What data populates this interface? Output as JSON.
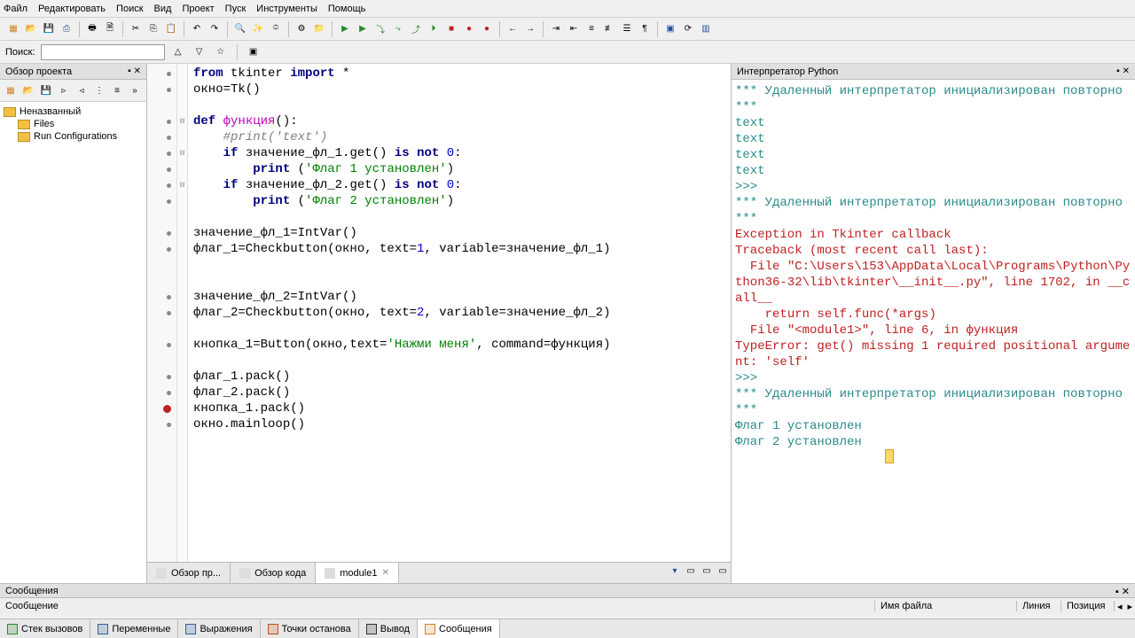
{
  "menu": {
    "file": "Файл",
    "edit": "Редактировать",
    "search": "Поиск",
    "view": "Вид",
    "project": "Проект",
    "run": "Пуск",
    "tools": "Инструменты",
    "help": "Помощь"
  },
  "search": {
    "label": "Поиск:",
    "value": ""
  },
  "sidebar": {
    "title": "Обзор проекта",
    "nodes": [
      {
        "label": "Неназванный",
        "indent": 0
      },
      {
        "label": "Files",
        "indent": 1
      },
      {
        "label": "Run Configurations",
        "indent": 1
      }
    ]
  },
  "editor": {
    "tabs": [
      {
        "label": "Обзор пр...",
        "closable": false
      },
      {
        "label": "Обзор кода",
        "closable": false
      },
      {
        "label": "module1",
        "closable": true,
        "active": true
      }
    ],
    "breakpoint_line": 22,
    "code": [
      {
        "t": "line",
        "spans": [
          {
            "c": "kw",
            "t": "from"
          },
          {
            "t": " tkinter "
          },
          {
            "c": "kw",
            "t": "import"
          },
          {
            "t": " *"
          }
        ]
      },
      {
        "t": "line",
        "spans": [
          {
            "t": "окно=Tk()"
          }
        ]
      },
      {
        "t": "blank"
      },
      {
        "t": "line",
        "fold": "-",
        "spans": [
          {
            "c": "kw",
            "t": "def"
          },
          {
            "t": " "
          },
          {
            "c": "fn",
            "t": "функция"
          },
          {
            "t": "():"
          }
        ]
      },
      {
        "t": "line",
        "spans": [
          {
            "t": "    "
          },
          {
            "c": "cm",
            "t": "#print('text')"
          }
        ]
      },
      {
        "t": "line",
        "fold": "-",
        "spans": [
          {
            "t": "    "
          },
          {
            "c": "kw",
            "t": "if"
          },
          {
            "t": " значение_фл_1.get() "
          },
          {
            "c": "kw",
            "t": "is not"
          },
          {
            "t": " "
          },
          {
            "c": "nm",
            "t": "0"
          },
          {
            "t": ":"
          }
        ]
      },
      {
        "t": "line",
        "spans": [
          {
            "t": "        "
          },
          {
            "c": "kw",
            "t": "print"
          },
          {
            "t": " ("
          },
          {
            "c": "str",
            "t": "'Флаг 1 установлен'"
          },
          {
            "t": ")"
          }
        ]
      },
      {
        "t": "line",
        "fold": "-",
        "spans": [
          {
            "t": "    "
          },
          {
            "c": "kw",
            "t": "if"
          },
          {
            "t": " значение_фл_2.get() "
          },
          {
            "c": "kw",
            "t": "is not"
          },
          {
            "t": " "
          },
          {
            "c": "nm",
            "t": "0"
          },
          {
            "t": ":"
          }
        ]
      },
      {
        "t": "line",
        "spans": [
          {
            "t": "        "
          },
          {
            "c": "kw",
            "t": "print"
          },
          {
            "t": " ("
          },
          {
            "c": "str",
            "t": "'Флаг 2 установлен'"
          },
          {
            "t": ")"
          }
        ]
      },
      {
        "t": "blank"
      },
      {
        "t": "line",
        "spans": [
          {
            "t": "значение_фл_1=IntVar()"
          }
        ]
      },
      {
        "t": "line",
        "spans": [
          {
            "t": "флаг_1=Checkbutton(окно, text="
          },
          {
            "c": "nm",
            "t": "1"
          },
          {
            "t": ", variable=значение_фл_1)"
          }
        ]
      },
      {
        "t": "blank"
      },
      {
        "t": "blank"
      },
      {
        "t": "line",
        "spans": [
          {
            "t": "значение_фл_2=IntVar()"
          }
        ]
      },
      {
        "t": "line",
        "spans": [
          {
            "t": "флаг_2=Checkbutton(окно, text="
          },
          {
            "c": "nm",
            "t": "2"
          },
          {
            "t": ", variable=значение_фл_2)"
          }
        ]
      },
      {
        "t": "blank"
      },
      {
        "t": "line",
        "spans": [
          {
            "t": "кнопка_1=Button(окно,text="
          },
          {
            "c": "str",
            "t": "'Нажми меня'"
          },
          {
            "t": ", command=функция)"
          }
        ]
      },
      {
        "t": "blank"
      },
      {
        "t": "line",
        "spans": [
          {
            "t": "флаг_1.pack()"
          }
        ]
      },
      {
        "t": "line",
        "spans": [
          {
            "t": "флаг_2.pack()"
          }
        ]
      },
      {
        "t": "line",
        "spans": [
          {
            "t": "кнопка_1.pack()"
          }
        ]
      },
      {
        "t": "line",
        "spans": [
          {
            "t": "окно.mainloop()"
          }
        ]
      }
    ]
  },
  "interpreter": {
    "title": "Интерпретатор Python",
    "lines": [
      {
        "c": "teal",
        "t": "*** Удаленный интерпретатор инициализирован повторно ***"
      },
      {
        "c": "teal",
        "t": "text"
      },
      {
        "c": "teal",
        "t": "text"
      },
      {
        "c": "teal",
        "t": "text"
      },
      {
        "c": "teal",
        "t": "text"
      },
      {
        "c": "teal",
        "t": ">>> "
      },
      {
        "c": "teal",
        "t": "*** Удаленный интерпретатор инициализирован повторно ***"
      },
      {
        "c": "red",
        "t": "Exception in Tkinter callback"
      },
      {
        "c": "red",
        "t": "Traceback (most recent call last):"
      },
      {
        "c": "red",
        "t": "  File \"C:\\Users\\153\\AppData\\Local\\Programs\\Python\\Python36-32\\lib\\tkinter\\__init__.py\", line 1702, in __call__"
      },
      {
        "c": "red",
        "t": "    return self.func(*args)"
      },
      {
        "c": "red",
        "t": "  File \"<module1>\", line 6, in функция"
      },
      {
        "c": "red",
        "t": "TypeError: get() missing 1 required positional argument: 'self'"
      },
      {
        "c": "teal",
        "t": ">>> "
      },
      {
        "c": "teal",
        "t": "*** Удаленный интерпретатор инициализирован повторно ***"
      },
      {
        "c": "teal",
        "t": "Флаг 1 установлен"
      },
      {
        "c": "teal",
        "t": "Флаг 2 установлен"
      }
    ]
  },
  "messages": {
    "title": "Сообщения",
    "cols": {
      "msg": "Сообщение",
      "file": "Имя файла",
      "line": "Линия",
      "pos": "Позиция"
    }
  },
  "bottom_tabs": [
    {
      "label": "Стек вызовов",
      "icon": "#2a8a2a"
    },
    {
      "label": "Переменные",
      "icon": "#3060a0"
    },
    {
      "label": "Выражения",
      "icon": "#3060a0"
    },
    {
      "label": "Точки останова",
      "icon": "#c05020"
    },
    {
      "label": "Вывод",
      "icon": "#303030"
    },
    {
      "label": "Сообщения",
      "icon": "#d08020",
      "active": true
    }
  ]
}
